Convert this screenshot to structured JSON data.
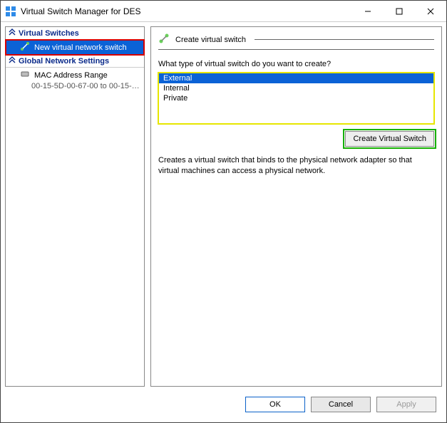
{
  "window": {
    "title": "Virtual Switch Manager for DES"
  },
  "tree": {
    "sections": [
      {
        "label": "Virtual Switches"
      },
      {
        "label": "Global Network Settings"
      }
    ],
    "new_switch_label": "New virtual network switch",
    "mac_range_label": "MAC Address Range",
    "mac_range_value": "00-15-5D-00-67-00 to 00-15-5D-0…"
  },
  "right": {
    "heading": "Create virtual switch",
    "prompt": "What type of virtual switch do you want to create?",
    "types": [
      "External",
      "Internal",
      "Private"
    ],
    "create_label": "Create Virtual Switch",
    "description": "Creates a virtual switch that binds to the physical network adapter so that virtual machines can access a physical network."
  },
  "footer": {
    "ok": "OK",
    "cancel": "Cancel",
    "apply": "Apply"
  }
}
